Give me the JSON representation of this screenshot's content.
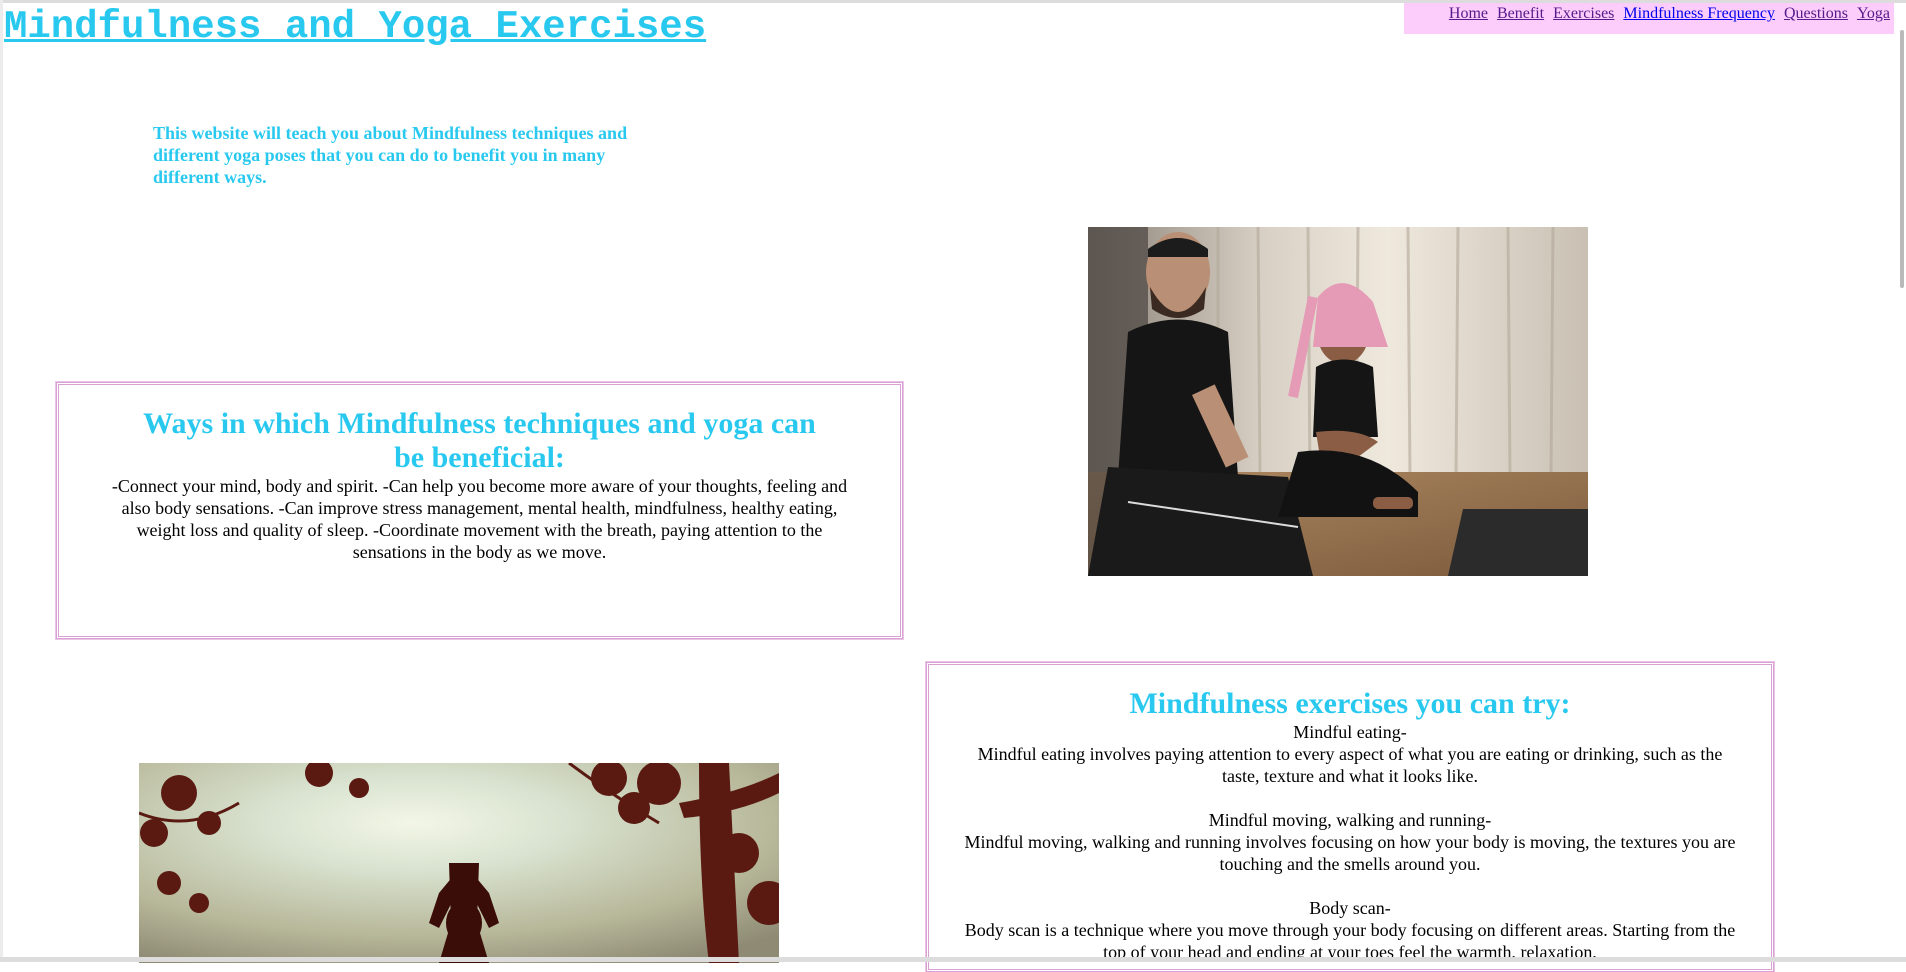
{
  "site": {
    "title": "Mindfulness and Yoga Exercises"
  },
  "nav": {
    "links": [
      {
        "label": "Home"
      },
      {
        "label": "Benefit"
      },
      {
        "label": "Exercises"
      },
      {
        "label": "Mindfulness Frequency"
      },
      {
        "label": "Questions"
      },
      {
        "label": "Yoga"
      }
    ]
  },
  "intro": {
    "text": "This website will teach you about Mindfulness techniques and different yoga poses that you can do to benefit you in many different ways."
  },
  "benefits": {
    "heading": "Ways in which Mindfulness techniques and yoga can be beneficial:",
    "body": "-Connect your mind, body and spirit. -Can help you become more aware of your thoughts, feeling and also body sensations. -Can improve stress management, mental health, mindfulness, healthy eating, weight loss and quality of sleep. -Coordinate movement with the breath, paying attention to the sensations in the body as we move."
  },
  "exercises": {
    "heading": "Mindfulness exercises you can try:",
    "items": [
      {
        "name": "Mindful eating-",
        "description": "Mindful eating involves paying attention to every aspect of what you are eating or drinking, such as the taste, texture and what it looks like."
      },
      {
        "name": "Mindful moving, walking and running-",
        "description": "Mindful moving, walking and running involves focusing on how your body is moving, the textures you are touching and the smells around you."
      },
      {
        "name": "Body scan-",
        "description": "Body scan is a technique where you move through your body focusing on different areas. Starting from the top of your head and ending at your toes feel the warmth, relaxation,"
      }
    ]
  },
  "colors": {
    "accent": "#29c9ef",
    "nav_background": "#fccdfa",
    "box_border": "#d9a0d3",
    "visited_link": "#551a8b",
    "unvisited_link": "#0000ee"
  }
}
